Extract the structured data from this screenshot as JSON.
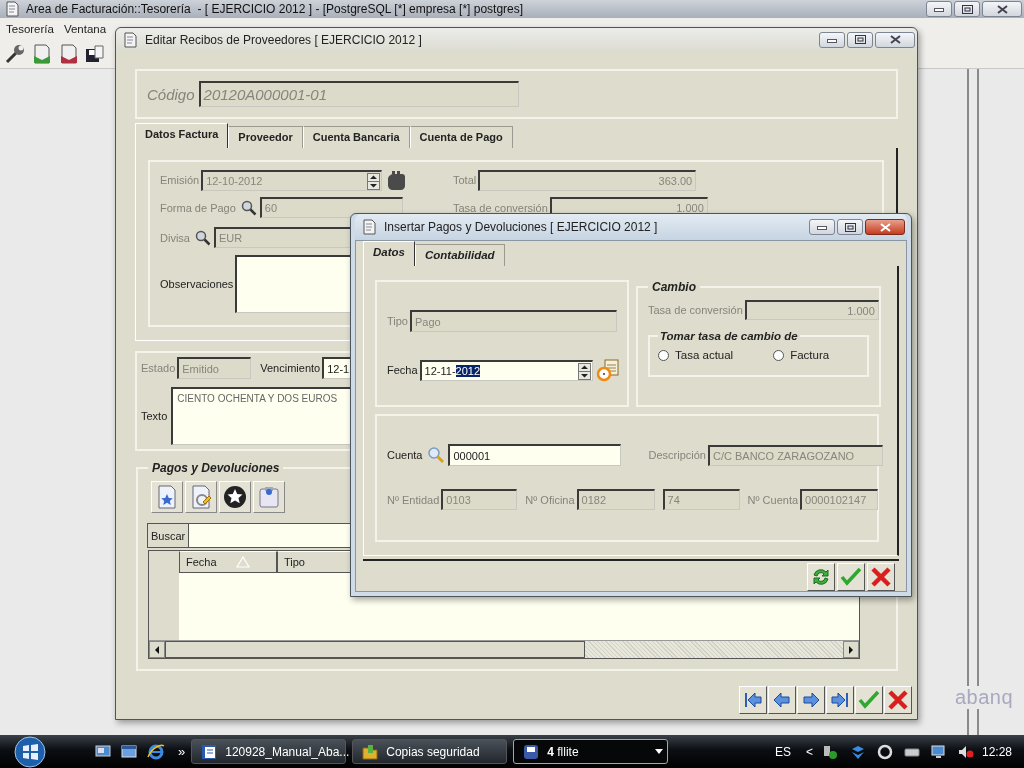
{
  "app": {
    "title": "Area de Facturación::Tesorería  - [ EJERCICIO 2012 ] - [PostgreSQL [*] empresa [*] postgres]",
    "menu": [
      {
        "label": "Tesorería"
      },
      {
        "label": "Ventana"
      }
    ]
  },
  "logo": "abanq",
  "edit_window": {
    "title": "Editar Recibos de Proveedores [ EJERCICIO 2012 ]",
    "active": false,
    "codigo": {
      "label": "Código",
      "value": "20120A000001-01",
      "editable": false
    },
    "tabs": [
      {
        "label": "Datos Factura",
        "selected": true
      },
      {
        "label": "Proveedor",
        "selected": false
      },
      {
        "label": "Cuenta Bancaria",
        "selected": false
      },
      {
        "label": "Cuenta de Pago",
        "selected": false
      }
    ],
    "emision": {
      "label": "Emisión",
      "value": "12-10-2012",
      "editable": false
    },
    "total": {
      "label": "Total",
      "value": "363.00",
      "editable": false
    },
    "forma_pago": {
      "label": "Forma de Pago",
      "value": "60",
      "editable": false
    },
    "tasa": {
      "label": "Tasa de conversión",
      "value": "1.000",
      "editable": false
    },
    "divisa": {
      "label": "Divisa",
      "value": "EUR",
      "editable": false
    },
    "observaciones": {
      "label": "Observaciones",
      "editable": true
    },
    "estado": {
      "label": "Estado",
      "value": "Emitido",
      "editable": false
    },
    "vencimiento": {
      "label": "Vencimiento",
      "value": "12-1",
      "editable": true
    },
    "texto": {
      "label": "Texto",
      "value": "CIENTO OCHENTA Y DOS EUROS",
      "editable": true
    },
    "pagos": {
      "title": "Pagos y Devoluciones",
      "search_label": "Buscar",
      "columns": [
        {
          "label": "Fecha",
          "sorted": true
        },
        {
          "label": "Tipo",
          "sorted": false
        }
      ]
    }
  },
  "dialog": {
    "title": "Insertar Pagos y Devoluciones [ EJERCICIO 2012 ]",
    "active": true,
    "tabs": [
      {
        "label": "Datos",
        "selected": true
      },
      {
        "label": "Contabilidad",
        "selected": false
      }
    ],
    "tipo": {
      "label": "Tipo",
      "value": "Pago",
      "editable": false
    },
    "fecha": {
      "label": "Fecha",
      "editable": true,
      "value": "12-11-",
      "selected_text": "2012"
    },
    "cambio": {
      "title": "Cambio",
      "tasa": {
        "label": "Tasa de conversión",
        "value": "1.000",
        "editable": false
      },
      "source_title": "Tomar tasa de cambio de",
      "options": [
        {
          "label": "Tasa actual",
          "selected": false
        },
        {
          "label": "Factura",
          "selected": false
        }
      ]
    },
    "cuenta": {
      "label": "Cuenta",
      "value": "000001",
      "editable": true
    },
    "descripcion": {
      "label": "Descripción",
      "value": "C/C BANCO ZARAGOZANO",
      "editable": false
    },
    "entidad": {
      "label": "Nº Entidad",
      "value": "0103",
      "editable": false
    },
    "oficina": {
      "label": "Nº Oficina",
      "value": "0182",
      "editable": false
    },
    "dc": {
      "value": "74",
      "editable": false
    },
    "numero_cuenta": {
      "label": "Nº Cuenta",
      "value": "0000102147",
      "editable": false
    }
  },
  "taskbar": {
    "chevron": "»",
    "items": [
      {
        "label": "120928_Manual_Aba...",
        "selected": false,
        "kind": "document"
      },
      {
        "label": "Copias seguridad",
        "selected": false,
        "kind": "folder"
      },
      {
        "count": "4",
        "label": "fllite",
        "selected": true,
        "kind": "app"
      }
    ],
    "language": "ES",
    "tray_arrow": "<",
    "clock": "12:28"
  }
}
